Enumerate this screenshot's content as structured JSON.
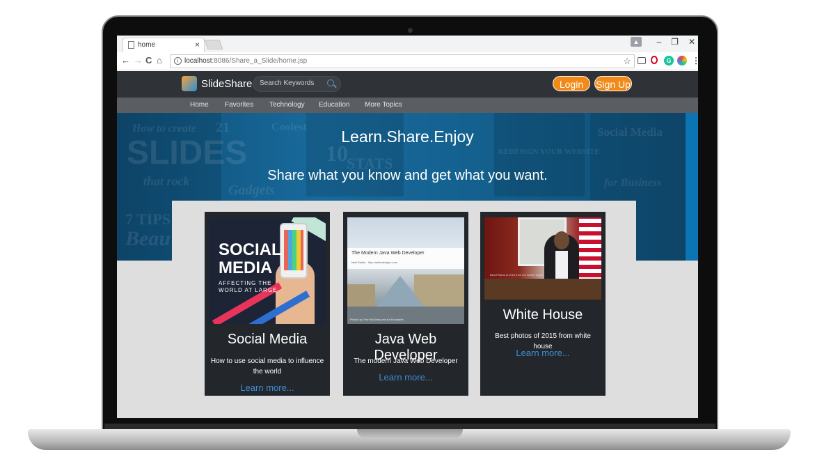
{
  "browser": {
    "tab_title": "home",
    "tab_close": "×",
    "url_host": "localhost",
    "url_rest": ":8086/Share_a_Slide/home.jsp",
    "window_controls": [
      "–",
      "❐",
      "✕"
    ],
    "nav": {
      "back": "←",
      "forward": "→",
      "reload": "C",
      "home": "⌂"
    },
    "bookmark_star": "☆",
    "extensions": [
      "cast-icon",
      "opera-icon",
      "grammarly-icon",
      "color-icon",
      "menu-icon"
    ]
  },
  "site": {
    "logo_text": "SlideShare",
    "search_placeholder": "Search Keywords",
    "login_label": "Login",
    "signup_label": "Sign Up",
    "nav": [
      "Home",
      "Favorites",
      "Technology",
      "Education",
      "More Topics"
    ]
  },
  "hero": {
    "title": "Learn.Share.Enjoy",
    "subtitle": "Share what you know and get what you want.",
    "background_text": [
      "How to create",
      "SLIDES",
      "that rock",
      "21",
      "Coolest",
      "10",
      "STATS",
      "Gadgets",
      "REDESIGN YOUR WEBSITE",
      "Social Media",
      "for Business",
      "7 TIPS",
      "Beau"
    ]
  },
  "cards": [
    {
      "title": "Social Media",
      "description": "How to use social media to influence the world",
      "link": "Learn more...",
      "thumb_big": "SOCIAL MEDIA",
      "thumb_small": "AFFECTING THE WORLD AT LARGE"
    },
    {
      "title": "Java Web Developer",
      "description": "The modern Java Web Developer",
      "link": "Learn more...",
      "thumb_title": "The Modern Java Web Developer",
      "thumb_sub": "Matt Raible · http://raibledesigns.com",
      "thumb_credit": "Photos by Trish McGinity and Art Escalante"
    },
    {
      "title": "White House",
      "description": "Best photos of 2015 from white house",
      "link": "Learn more...",
      "thumb_caption": "Best Photos of 2015 from the White House"
    }
  ],
  "colors": {
    "header_bg": "#2f3236",
    "subnav_bg": "#5a5d61",
    "accent_orange": "#f28a1a",
    "hero_blue": "#186a9c",
    "card_bg": "#23262b",
    "link_blue": "#3d8ed6",
    "content_bg": "#dedede"
  }
}
